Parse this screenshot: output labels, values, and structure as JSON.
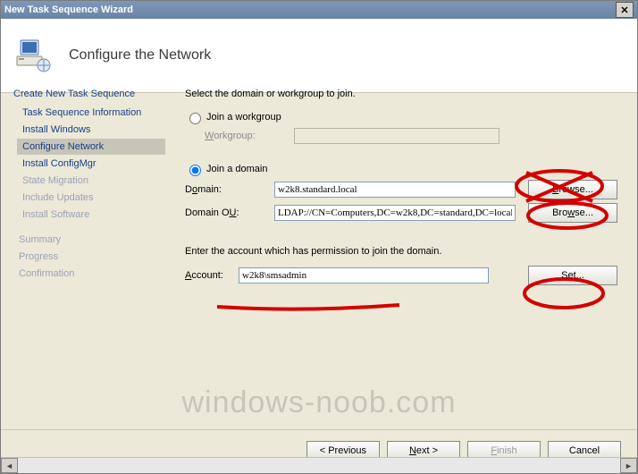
{
  "window": {
    "title": "New Task Sequence Wizard"
  },
  "header": {
    "page_title": "Configure the Network"
  },
  "sidebar": {
    "group_title": "Create New Task Sequence",
    "steps": [
      {
        "label": "Task Sequence Information",
        "state": "done"
      },
      {
        "label": "Install Windows",
        "state": "done"
      },
      {
        "label": "Configure Network",
        "state": "sel"
      },
      {
        "label": "Install ConfigMgr",
        "state": "next"
      },
      {
        "label": "State Migration",
        "state": "dis"
      },
      {
        "label": "Include Updates",
        "state": "dis"
      },
      {
        "label": "Install Software",
        "state": "dis"
      }
    ],
    "bottom": [
      {
        "label": "Summary"
      },
      {
        "label": "Progress"
      },
      {
        "label": "Confirmation"
      }
    ]
  },
  "content": {
    "intro": "Select the domain or workgroup to join.",
    "workgroup": {
      "radio_label": "Join a workgroup",
      "label": "Workgroup:",
      "value": "",
      "selected": false
    },
    "domain": {
      "radio_label": "Join a domain",
      "selected": true,
      "domain_label": "Domain:",
      "domain_value": "w2k8.standard.local",
      "ou_label": "Domain OU:",
      "ou_value": "LDAP://CN=Computers,DC=w2k8,DC=standard,DC=local",
      "browse_label": "Browse..."
    },
    "account": {
      "intro": "Enter the account which has permission to join the domain.",
      "label": "Account:",
      "value": "w2k8\\smsadmin",
      "set_label": "Set..."
    }
  },
  "footer": {
    "previous": "< Previous",
    "next": "Next >",
    "finish": "Finish",
    "cancel": "Cancel"
  },
  "watermark": "windows-noob.com"
}
